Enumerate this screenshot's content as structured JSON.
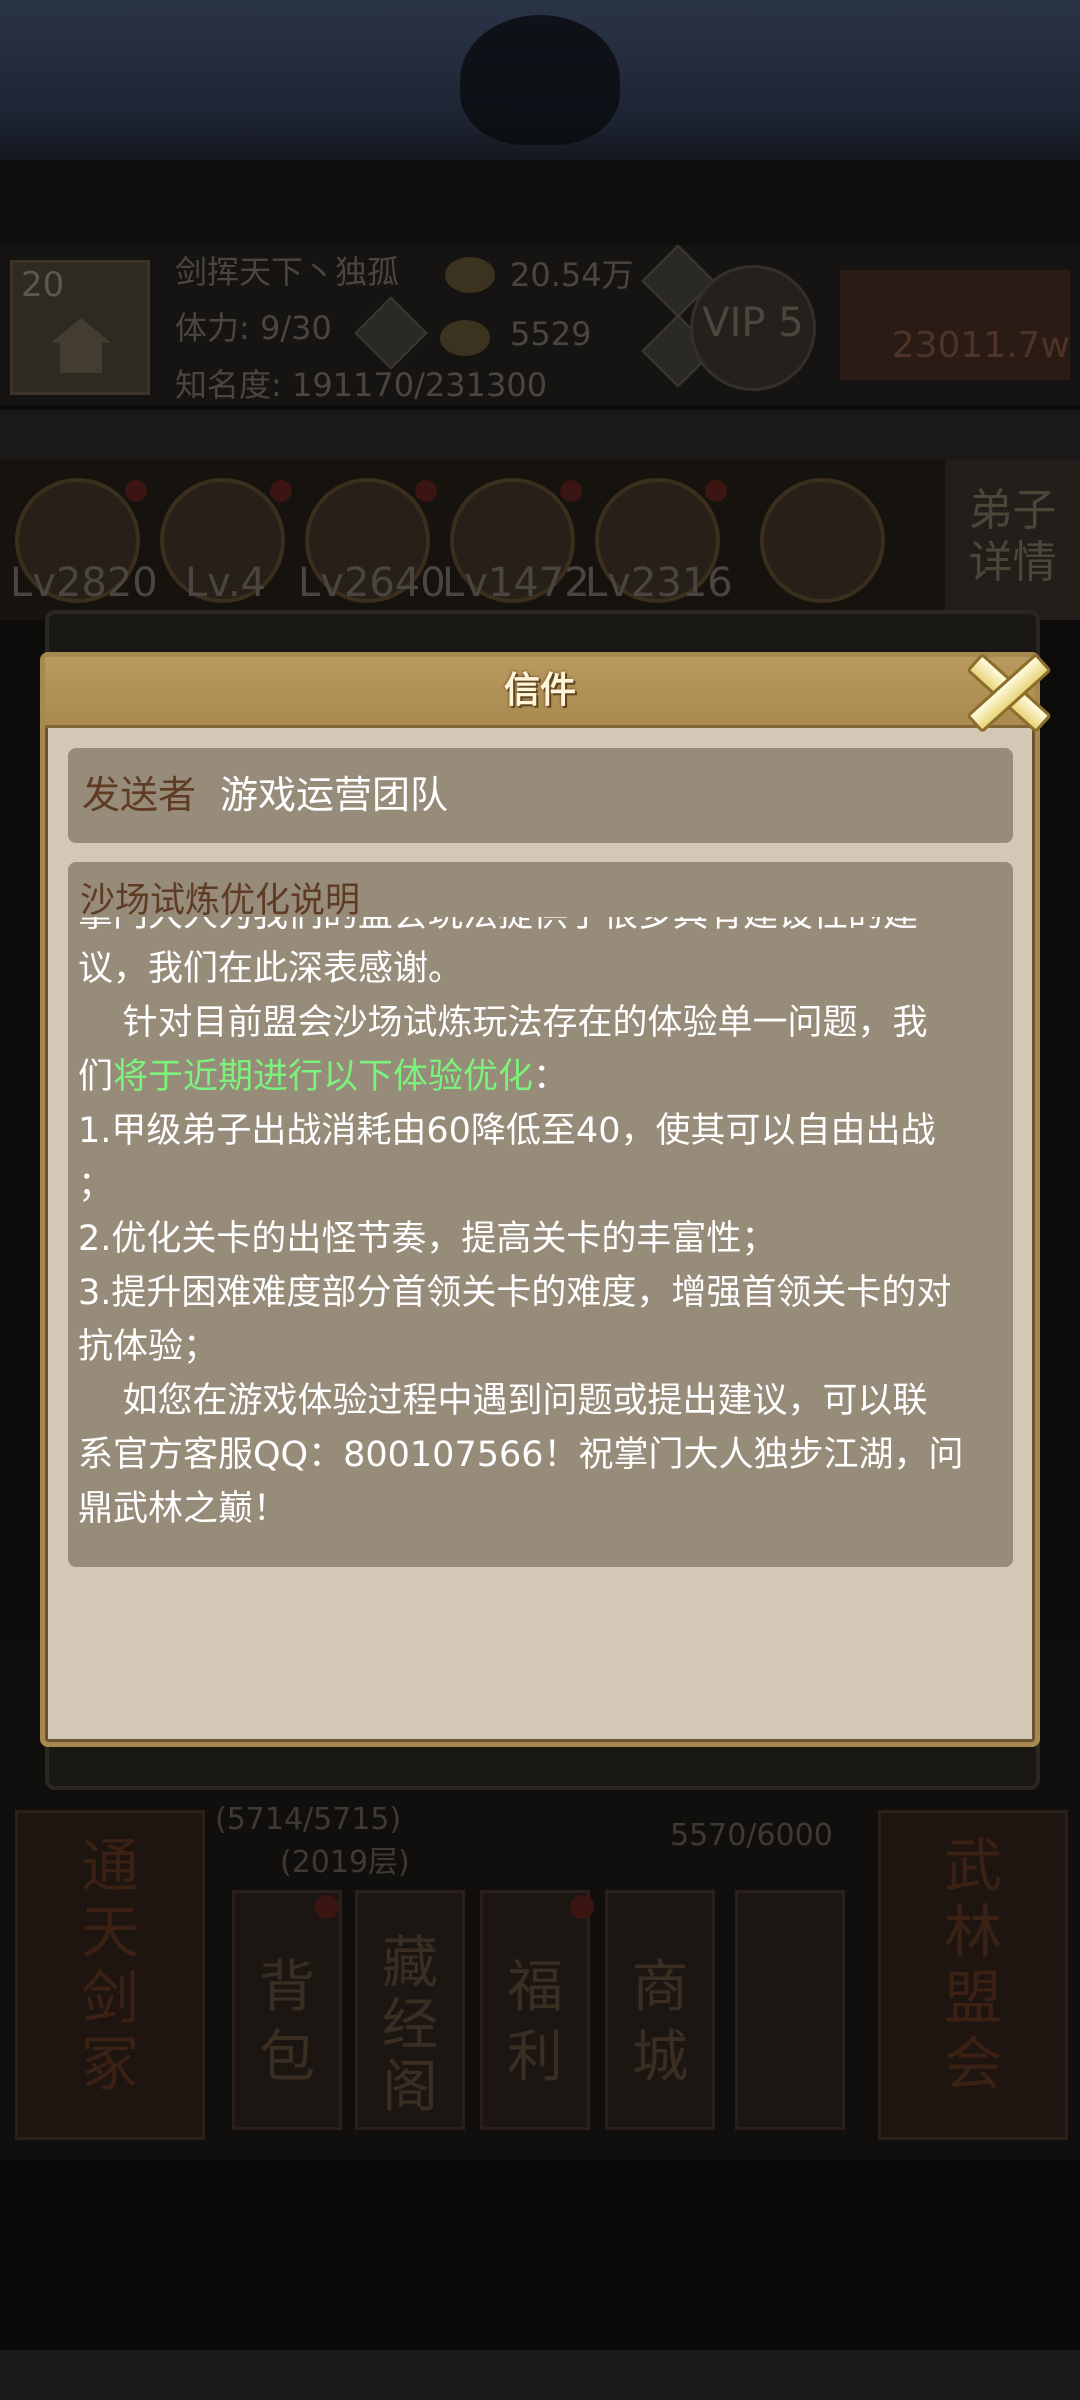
{
  "background": {
    "player": {
      "level": "20",
      "name": "剑挥天下丶独孤",
      "stamina": "体力: 9/30",
      "fame": "知名度: 191170/231300",
      "silver": "20.54万",
      "gold": "5529",
      "vip": "VIP 5",
      "power": "23011.7w"
    },
    "heroes": [
      "Lv2820",
      "Lv.4",
      "Lv2640",
      "Lv1472",
      "Lv2316"
    ],
    "disciple_button": "弟子\n详情",
    "tower": {
      "progress": "(5714/5715)",
      "floor": "(2019层)",
      "energy": "5570/6000"
    },
    "left_card": "通\n天\n剑\n冢",
    "right_card": "武\n林\n盟\n会",
    "menu": [
      "背\n包",
      "藏\n经\n阁",
      "福\n利",
      "商\n城"
    ]
  },
  "dialog": {
    "title": "信件",
    "sender_label": "发送者",
    "sender_name": "游戏运营团队",
    "subject": "沙场试炼优化说明",
    "body": {
      "line0": "掌门大人为我们的盟会玩法提供了很多具有建设性的建",
      "line1": "议，我们在此深表感谢。",
      "line2": "    针对目前盟会沙场试炼玩法存在的体验单一问题，我",
      "line3_a": "们",
      "line3_green": "将于近期进行以下体验优化",
      "line3_b": "：",
      "line4": "1.甲级弟子出战消耗由60降低至40，使其可以自由出战",
      "line5": "；",
      "line6": "2.优化关卡的出怪节奏，提高关卡的丰富性；",
      "line7": "3.提升困难难度部分首领关卡的难度，增强首领关卡的对",
      "line8": "抗体验；",
      "line9": "    如您在游戏体验过程中遇到问题或提出建议，可以联",
      "line10": "系官方客服QQ：800107566！祝掌门大人独步江湖，问",
      "line11": "鼎武林之巅！"
    }
  },
  "colors": {
    "dialog_bg": "#d3c8b5",
    "box_bg": "#978b79",
    "highlight": "#7cf27c",
    "header": "#b9995d"
  },
  "icons": [
    "close-x-icon",
    "silver-ingot-icon",
    "gold-coin-icon",
    "plus-icon",
    "vip-badge-icon"
  ]
}
